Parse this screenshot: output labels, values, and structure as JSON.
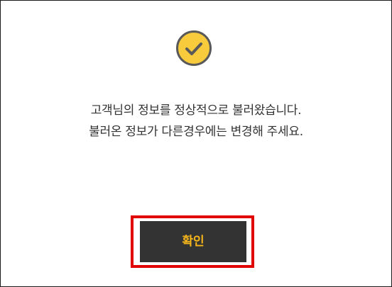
{
  "dialog": {
    "icon": "check-circle-icon",
    "message_line1": "고객님의 정보를 정상적으로 불러왔습니다.",
    "message_line2": "불러온 정보가 다른경우에는 변경해 주세요.",
    "confirm_label": "확인"
  },
  "colors": {
    "icon_fill": "#f7cb3c",
    "icon_stroke": "#595959",
    "button_bg": "#333333",
    "button_text": "#f5b51b",
    "highlight_border": "#e00000",
    "text": "#333333"
  }
}
